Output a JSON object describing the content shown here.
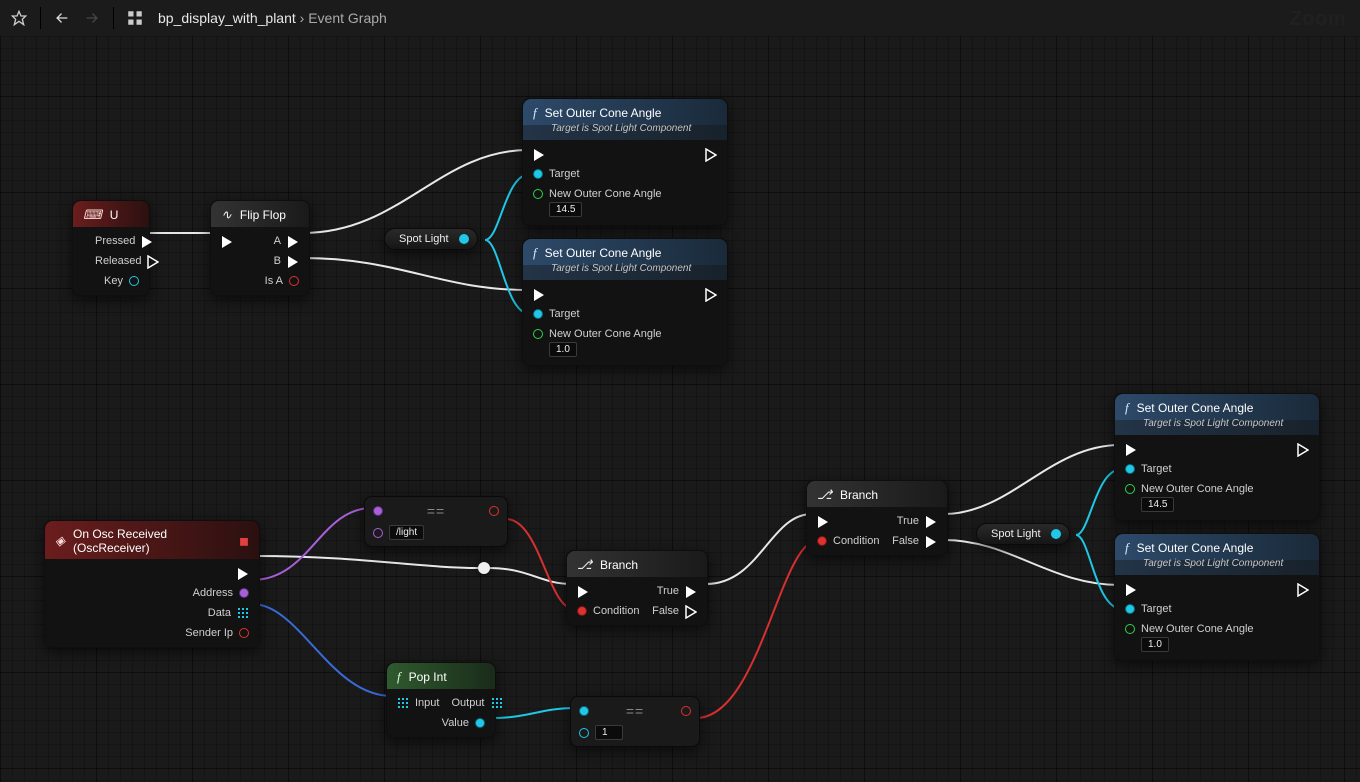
{
  "toolbar": {
    "breadcrumb_bp": "bp_display_with_plant",
    "breadcrumb_sep": "›",
    "breadcrumb_graph": "Event Graph",
    "zoom_label": "Zoom"
  },
  "nodes": {
    "input_u": {
      "title": "U",
      "pins": {
        "pressed": "Pressed",
        "released": "Released",
        "key": "Key"
      }
    },
    "flipflop": {
      "title": "Flip Flop",
      "pins": {
        "a": "A",
        "b": "B",
        "isa": "Is A"
      }
    },
    "spotlight_var1": "Spot Light",
    "spotlight_var2": "Spot Light",
    "set_cone": {
      "title": "Set Outer Cone Angle",
      "subtitle": "Target is Spot Light Component",
      "target": "Target",
      "param": "New Outer Cone Angle"
    },
    "set_cone_values": {
      "a": "14.5",
      "b": "1.0",
      "c": "14.5",
      "d": "1.0"
    },
    "osc": {
      "title": "On Osc Received (OscReceiver)",
      "address": "Address",
      "data": "Data",
      "senderip": "Sender Ip"
    },
    "eq_str": {
      "value": "/light"
    },
    "eq_int": {
      "value": "1"
    },
    "branch": {
      "title": "Branch",
      "cond": "Condition",
      "true": "True",
      "false": "False"
    },
    "popint": {
      "title": "Pop Int",
      "input": "Input",
      "output": "Output",
      "value": "Value"
    }
  }
}
